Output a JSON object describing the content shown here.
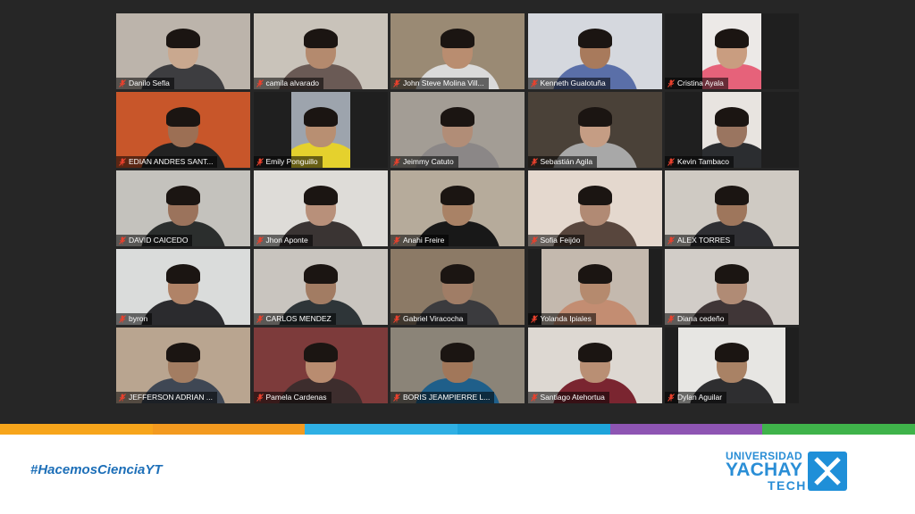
{
  "participants": [
    {
      "name": "Danilo Sefla",
      "bg": "#bcb4ab",
      "skin": "#c9a88f",
      "shirt": "#3d3d40",
      "frame": "full"
    },
    {
      "name": "camila alvarado",
      "bg": "#c9c3ba",
      "skin": "#b48a6e",
      "shirt": "#6a5a55",
      "frame": "full"
    },
    {
      "name": "John Steve Molina Vill...",
      "bg": "#9a8a74",
      "skin": "#b98d70",
      "shirt": "#dadada",
      "frame": "full"
    },
    {
      "name": "Kenneth Gualotuña",
      "bg": "#d5d8de",
      "skin": "#a87a5c",
      "shirt": "#5a6fa8",
      "frame": "full"
    },
    {
      "name": "Cristina Ayala",
      "bg": "#ece9e7",
      "skin": "#c99d80",
      "shirt": "#e6627a",
      "frame": "narrow"
    },
    {
      "name": "EDIAN ANDRES SANT...",
      "bg": "#c8562a",
      "skin": "#9c6f54",
      "shirt": "#222222",
      "frame": "full"
    },
    {
      "name": "Emily Ponguillo",
      "bg": "#9da4ad",
      "skin": "#b88f72",
      "shirt": "#e5d12d",
      "frame": "narrow"
    },
    {
      "name": "Jeimmy Catuto",
      "bg": "#a39d95",
      "skin": "#b18d77",
      "shirt": "#8b8787",
      "frame": "full"
    },
    {
      "name": "Sebastián Agila",
      "bg": "#4a4138",
      "skin": "#c59d84",
      "shirt": "#a8a8a8",
      "frame": "full"
    },
    {
      "name": "Kevin Tambaco",
      "bg": "#e8e4e0",
      "skin": "#9a7560",
      "shirt": "#2b2d30",
      "frame": "narrow"
    },
    {
      "name": "DAVID CAICEDO",
      "bg": "#c4c2bd",
      "skin": "#9b735c",
      "shirt": "#2b2e2d",
      "frame": "full"
    },
    {
      "name": "Jhon Aponte",
      "bg": "#dedcd8",
      "skin": "#b8907a",
      "shirt": "#3a3433",
      "frame": "full"
    },
    {
      "name": "Anahi Freire",
      "bg": "#b6ab9b",
      "skin": "#a98266",
      "shirt": "#181818",
      "frame": "full"
    },
    {
      "name": "Sofia Feijóo",
      "bg": "#e4d8ce",
      "skin": "#b18a74",
      "shirt": "#58463d",
      "frame": "full"
    },
    {
      "name": "ALEX TORRES",
      "bg": "#cfcac3",
      "skin": "#9e765c",
      "shirt": "#2f2f33",
      "frame": "full"
    },
    {
      "name": "byron",
      "bg": "#dadcdb",
      "skin": "#b08367",
      "shirt": "#2b2b2e",
      "frame": "full"
    },
    {
      "name": "CARLOS MENDEZ",
      "bg": "#c9c5bf",
      "skin": "#a27c63",
      "shirt": "#2e3538",
      "frame": "full"
    },
    {
      "name": "Gabriel Viracocha",
      "bg": "#8c7a66",
      "skin": "#a07d66",
      "shirt": "#3b3b3e",
      "frame": "full"
    },
    {
      "name": "Yolanda Ipiales",
      "bg": "#c4b9ae",
      "skin": "#b58a6e",
      "shirt": "#c38d72",
      "frame": "mid"
    },
    {
      "name": "Diana cedeño",
      "bg": "#d2cdc8",
      "skin": "#b08b75",
      "shirt": "#403637",
      "frame": "full"
    },
    {
      "name": "JEFFERSON ADRIAN ...",
      "bg": "#b9a590",
      "skin": "#a37d62",
      "shirt": "#3f4754",
      "frame": "full"
    },
    {
      "name": "Pamela Cardenas",
      "bg": "#7d3b3b",
      "skin": "#b98c70",
      "shirt": "#3d2d2d",
      "frame": "full"
    },
    {
      "name": "BORIS JEAMPIERRE L...",
      "bg": "#8b8478",
      "skin": "#a1775a",
      "shirt": "#1f5f8a",
      "frame": "full"
    },
    {
      "name": "Santiago Atehortua",
      "bg": "#ddd8d2",
      "skin": "#b98f74",
      "shirt": "#7a2530",
      "frame": "full"
    },
    {
      "name": "Dylan Aguilar",
      "bg": "#e7e6e3",
      "skin": "#a98265",
      "shirt": "#2e2e30",
      "frame": "mid"
    }
  ],
  "stripe_colors": [
    "#f7a51b",
    "#f39a1f",
    "#2fb0e4",
    "#1ea4db",
    "#8e55b3",
    "#3fb34a"
  ],
  "footer": {
    "hashtag_prefix": "#Hacemos",
    "hashtag_highlight": "CienciaYT",
    "logo_line1": "UNIVERSIDAD",
    "logo_line2": "YACHAY",
    "logo_line3": "TECH"
  },
  "icons": {
    "muted": "microphone-muted-icon"
  },
  "colors": {
    "mute_red": "#e8412d",
    "brand_blue": "#1f8fd8"
  }
}
